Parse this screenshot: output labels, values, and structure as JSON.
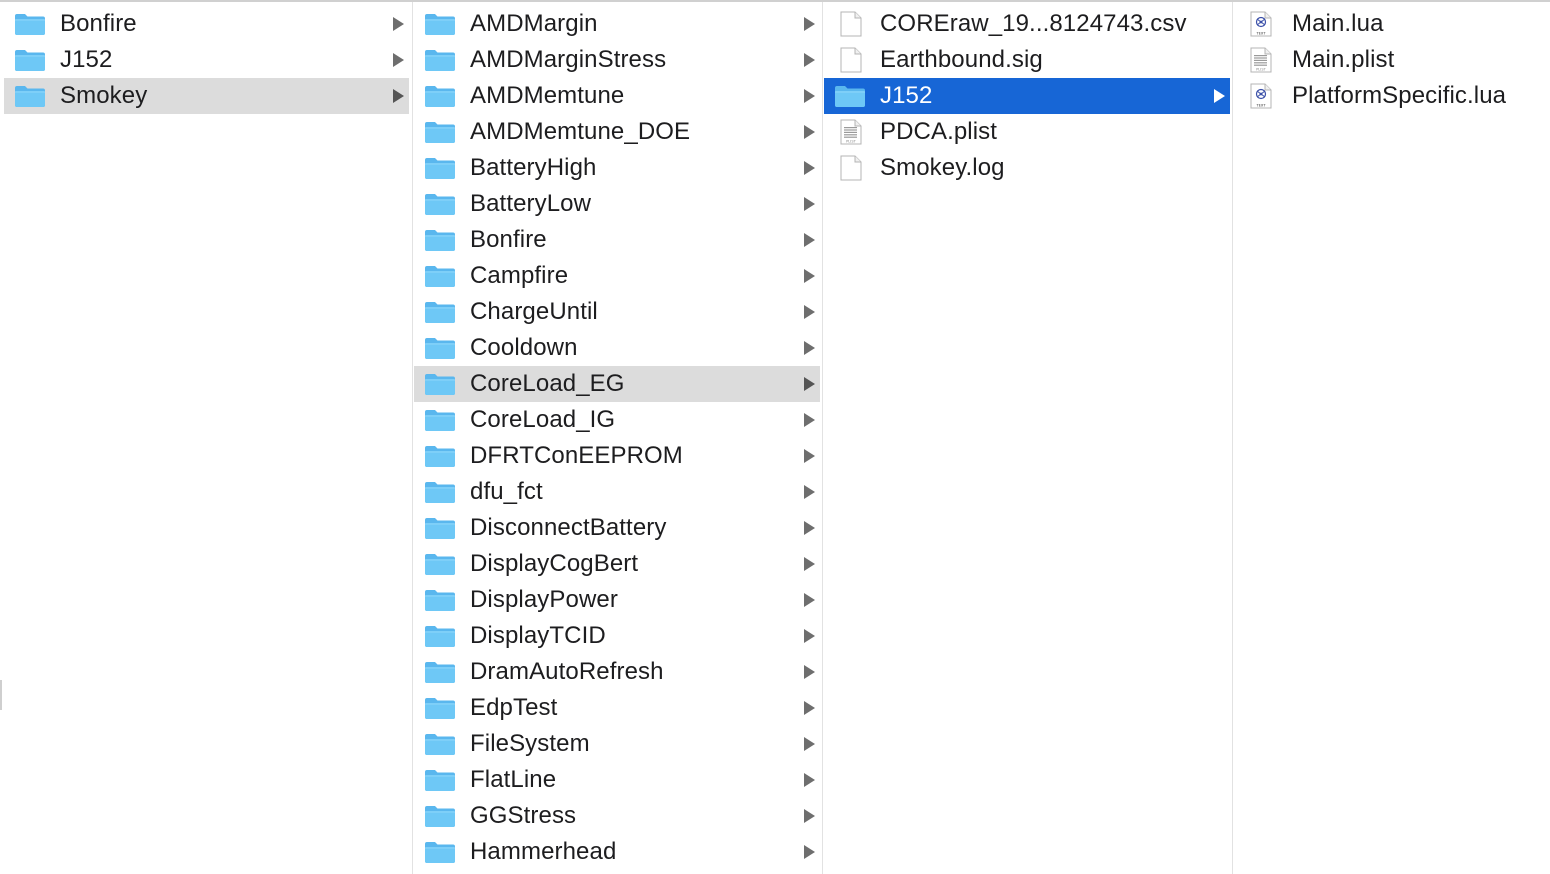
{
  "columns": [
    {
      "items": [
        {
          "label": "Bonfire",
          "kind": "folder",
          "arrow": true,
          "state": "none"
        },
        {
          "label": "J152",
          "kind": "folder",
          "arrow": true,
          "state": "none"
        },
        {
          "label": "Smokey",
          "kind": "folder",
          "arrow": true,
          "state": "selected-inactive"
        }
      ]
    },
    {
      "items": [
        {
          "label": "AMDMargin",
          "kind": "folder",
          "arrow": true,
          "state": "none"
        },
        {
          "label": "AMDMarginStress",
          "kind": "folder",
          "arrow": true,
          "state": "none"
        },
        {
          "label": "AMDMemtune",
          "kind": "folder",
          "arrow": true,
          "state": "none"
        },
        {
          "label": "AMDMemtune_DOE",
          "kind": "folder",
          "arrow": true,
          "state": "none"
        },
        {
          "label": "BatteryHigh",
          "kind": "folder",
          "arrow": true,
          "state": "none"
        },
        {
          "label": "BatteryLow",
          "kind": "folder",
          "arrow": true,
          "state": "none"
        },
        {
          "label": "Bonfire",
          "kind": "folder",
          "arrow": true,
          "state": "none"
        },
        {
          "label": "Campfire",
          "kind": "folder",
          "arrow": true,
          "state": "none"
        },
        {
          "label": "ChargeUntil",
          "kind": "folder",
          "arrow": true,
          "state": "none"
        },
        {
          "label": "Cooldown",
          "kind": "folder",
          "arrow": true,
          "state": "none"
        },
        {
          "label": "CoreLoad_EG",
          "kind": "folder",
          "arrow": true,
          "state": "selected-inactive"
        },
        {
          "label": "CoreLoad_IG",
          "kind": "folder",
          "arrow": true,
          "state": "none"
        },
        {
          "label": "DFRTConEEPROM",
          "kind": "folder",
          "arrow": true,
          "state": "none"
        },
        {
          "label": "dfu_fct",
          "kind": "folder",
          "arrow": true,
          "state": "none"
        },
        {
          "label": "DisconnectBattery",
          "kind": "folder",
          "arrow": true,
          "state": "none"
        },
        {
          "label": "DisplayCogBert",
          "kind": "folder",
          "arrow": true,
          "state": "none"
        },
        {
          "label": "DisplayPower",
          "kind": "folder",
          "arrow": true,
          "state": "none"
        },
        {
          "label": "DisplayTCID",
          "kind": "folder",
          "arrow": true,
          "state": "none"
        },
        {
          "label": "DramAutoRefresh",
          "kind": "folder",
          "arrow": true,
          "state": "none"
        },
        {
          "label": "EdpTest",
          "kind": "folder",
          "arrow": true,
          "state": "none"
        },
        {
          "label": "FileSystem",
          "kind": "folder",
          "arrow": true,
          "state": "none"
        },
        {
          "label": "FlatLine",
          "kind": "folder",
          "arrow": true,
          "state": "none"
        },
        {
          "label": "GGStress",
          "kind": "folder",
          "arrow": true,
          "state": "none"
        },
        {
          "label": "Hammerhead",
          "kind": "folder",
          "arrow": true,
          "state": "none"
        }
      ]
    },
    {
      "items": [
        {
          "label": "COREraw_19...8124743.csv",
          "kind": "blank-doc",
          "arrow": false,
          "state": "none"
        },
        {
          "label": "Earthbound.sig",
          "kind": "blank-doc",
          "arrow": false,
          "state": "none"
        },
        {
          "label": "J152",
          "kind": "folder",
          "arrow": true,
          "state": "selected-active"
        },
        {
          "label": "PDCA.plist",
          "kind": "plist-doc",
          "arrow": false,
          "state": "none"
        },
        {
          "label": "Smokey.log",
          "kind": "blank-doc",
          "arrow": false,
          "state": "none"
        }
      ]
    },
    {
      "items": [
        {
          "label": "Main.lua",
          "kind": "lua-doc",
          "arrow": false,
          "state": "none"
        },
        {
          "label": "Main.plist",
          "kind": "plist-doc",
          "arrow": false,
          "state": "none"
        },
        {
          "label": "PlatformSpecific.lua",
          "kind": "lua-doc",
          "arrow": false,
          "state": "none"
        }
      ]
    }
  ],
  "badges": {
    "plist": "PLIST",
    "text": "TEXT"
  },
  "colors": {
    "selection_active": "#1766d6",
    "selection_inactive": "#dcdcdc",
    "folder_front": "#6ec8f6",
    "folder_back": "#5ab7ee"
  }
}
